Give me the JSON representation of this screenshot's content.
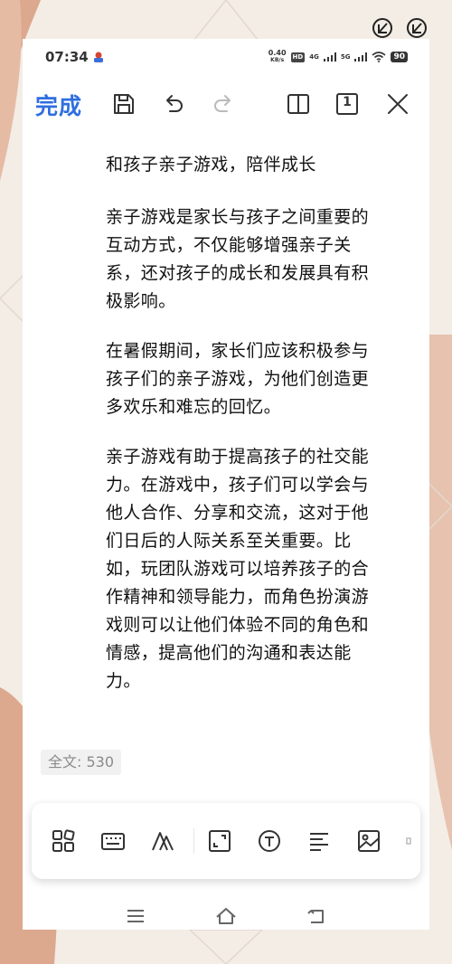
{
  "status_bar": {
    "time": "07:34",
    "net_speed_value": "0.40",
    "net_speed_unit": "KB/s",
    "hd_label": "HD",
    "sim1_label": "4G",
    "sim2_label": "5G",
    "battery": "90"
  },
  "toolbar": {
    "done_label": "完成",
    "icons": [
      "save-icon",
      "undo-icon",
      "redo-icon",
      "split-view-icon",
      "page-icon",
      "close-icon"
    ],
    "page_number": "1"
  },
  "document": {
    "title": "和孩子亲子游戏，陪伴成长",
    "paragraphs": [
      "亲子游戏是家长与孩子之间重要的互动方式，不仅能够增强亲子关系，还对孩子的成长和发展具有积极影响。",
      "在暑假期间，家长们应该积极参与孩子们的亲子游戏，为他们创造更多欢乐和难忘的回忆。",
      "亲子游戏有助于提高孩子的社交能力。在游戏中，孩子们可以学会与他人合作、分享和交流，这对于他们日后的人际关系至关重要。比如，玩团队游戏可以培养孩子的合作精神和领导能力，而角色扮演游戏则可以让他们体验不同的角色和情感，提高他们的沟通和表达能力。"
    ],
    "word_count": "全文: 530"
  },
  "format_bar": {
    "icons": [
      "grid-icon",
      "keyboard-icon",
      "text-style-icon",
      "expand-icon",
      "text-box-icon",
      "align-icon",
      "image-icon"
    ]
  },
  "nav_bar": {
    "icons": [
      "menu-icon",
      "home-icon",
      "back-icon"
    ]
  },
  "colors": {
    "accent": "#2f6ee0",
    "background": "#f3ede6",
    "decor": "#dca88e"
  }
}
